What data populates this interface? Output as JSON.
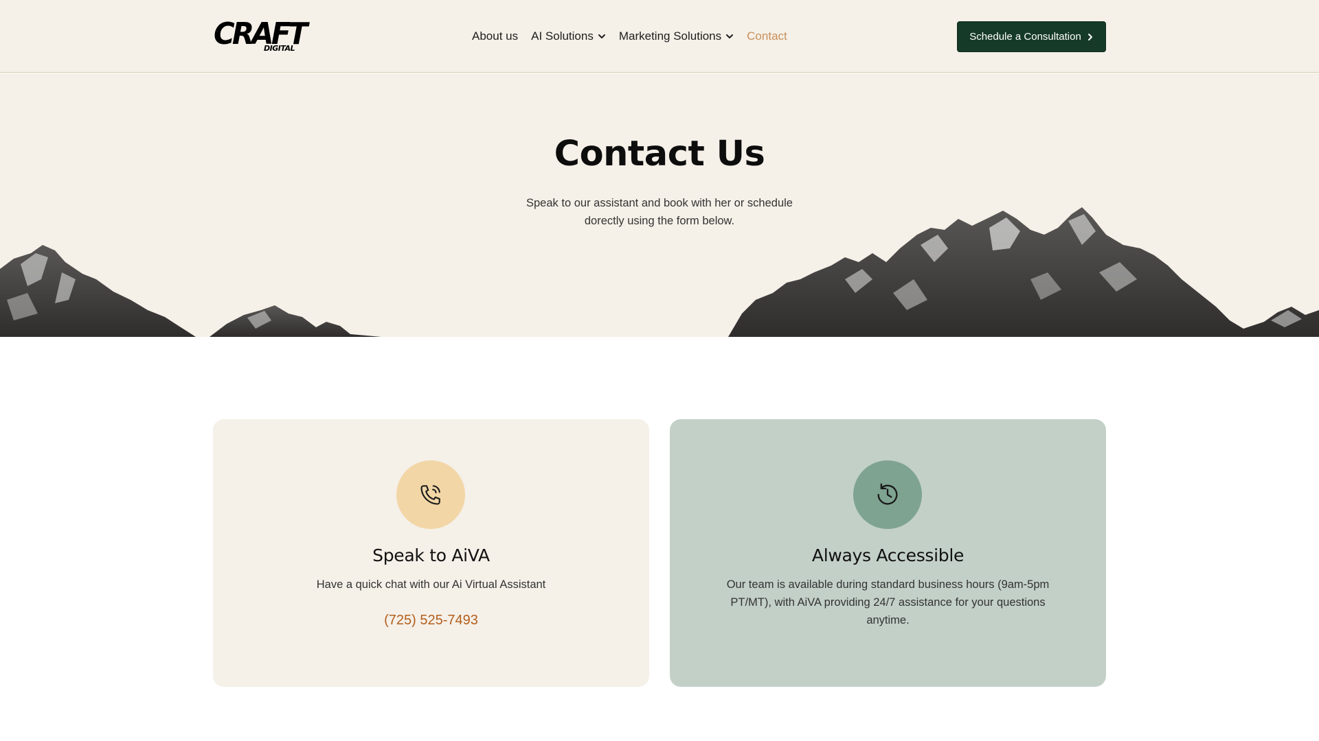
{
  "header": {
    "logo_main": "CRAFT",
    "logo_sub": "DIGITAL",
    "nav": [
      {
        "label": "About us",
        "has_dropdown": false,
        "active": false
      },
      {
        "label": "AI Solutions",
        "has_dropdown": true,
        "active": false
      },
      {
        "label": "Marketing Solutions",
        "has_dropdown": true,
        "active": false
      },
      {
        "label": "Contact",
        "has_dropdown": false,
        "active": true
      }
    ],
    "cta_label": "Schedule a Consultation"
  },
  "hero": {
    "title": "Contact Us",
    "subtitle": "Speak to our assistant and book with her or schedule dorectly using the form below."
  },
  "cards": [
    {
      "icon": "phone-icon",
      "title": "Speak to AiVA",
      "text": "Have a quick chat with our Ai Virtual Assistant",
      "phone": "(725) 525-7493"
    },
    {
      "icon": "history-icon",
      "title": "Always Accessible",
      "text": "Our team is available during standard business hours (9am-5pm PT/MT), with AiVA providing 24/7 assistance for your questions anytime."
    }
  ],
  "colors": {
    "background_beige": "#f5f0e8",
    "cta_green": "#163a28",
    "nav_active": "#c8905a",
    "phone_orange": "#b35e1c",
    "card_right_bg": "#c3d0c8",
    "phone_circle": "#f2d6a6",
    "history_circle": "#7ea391"
  }
}
